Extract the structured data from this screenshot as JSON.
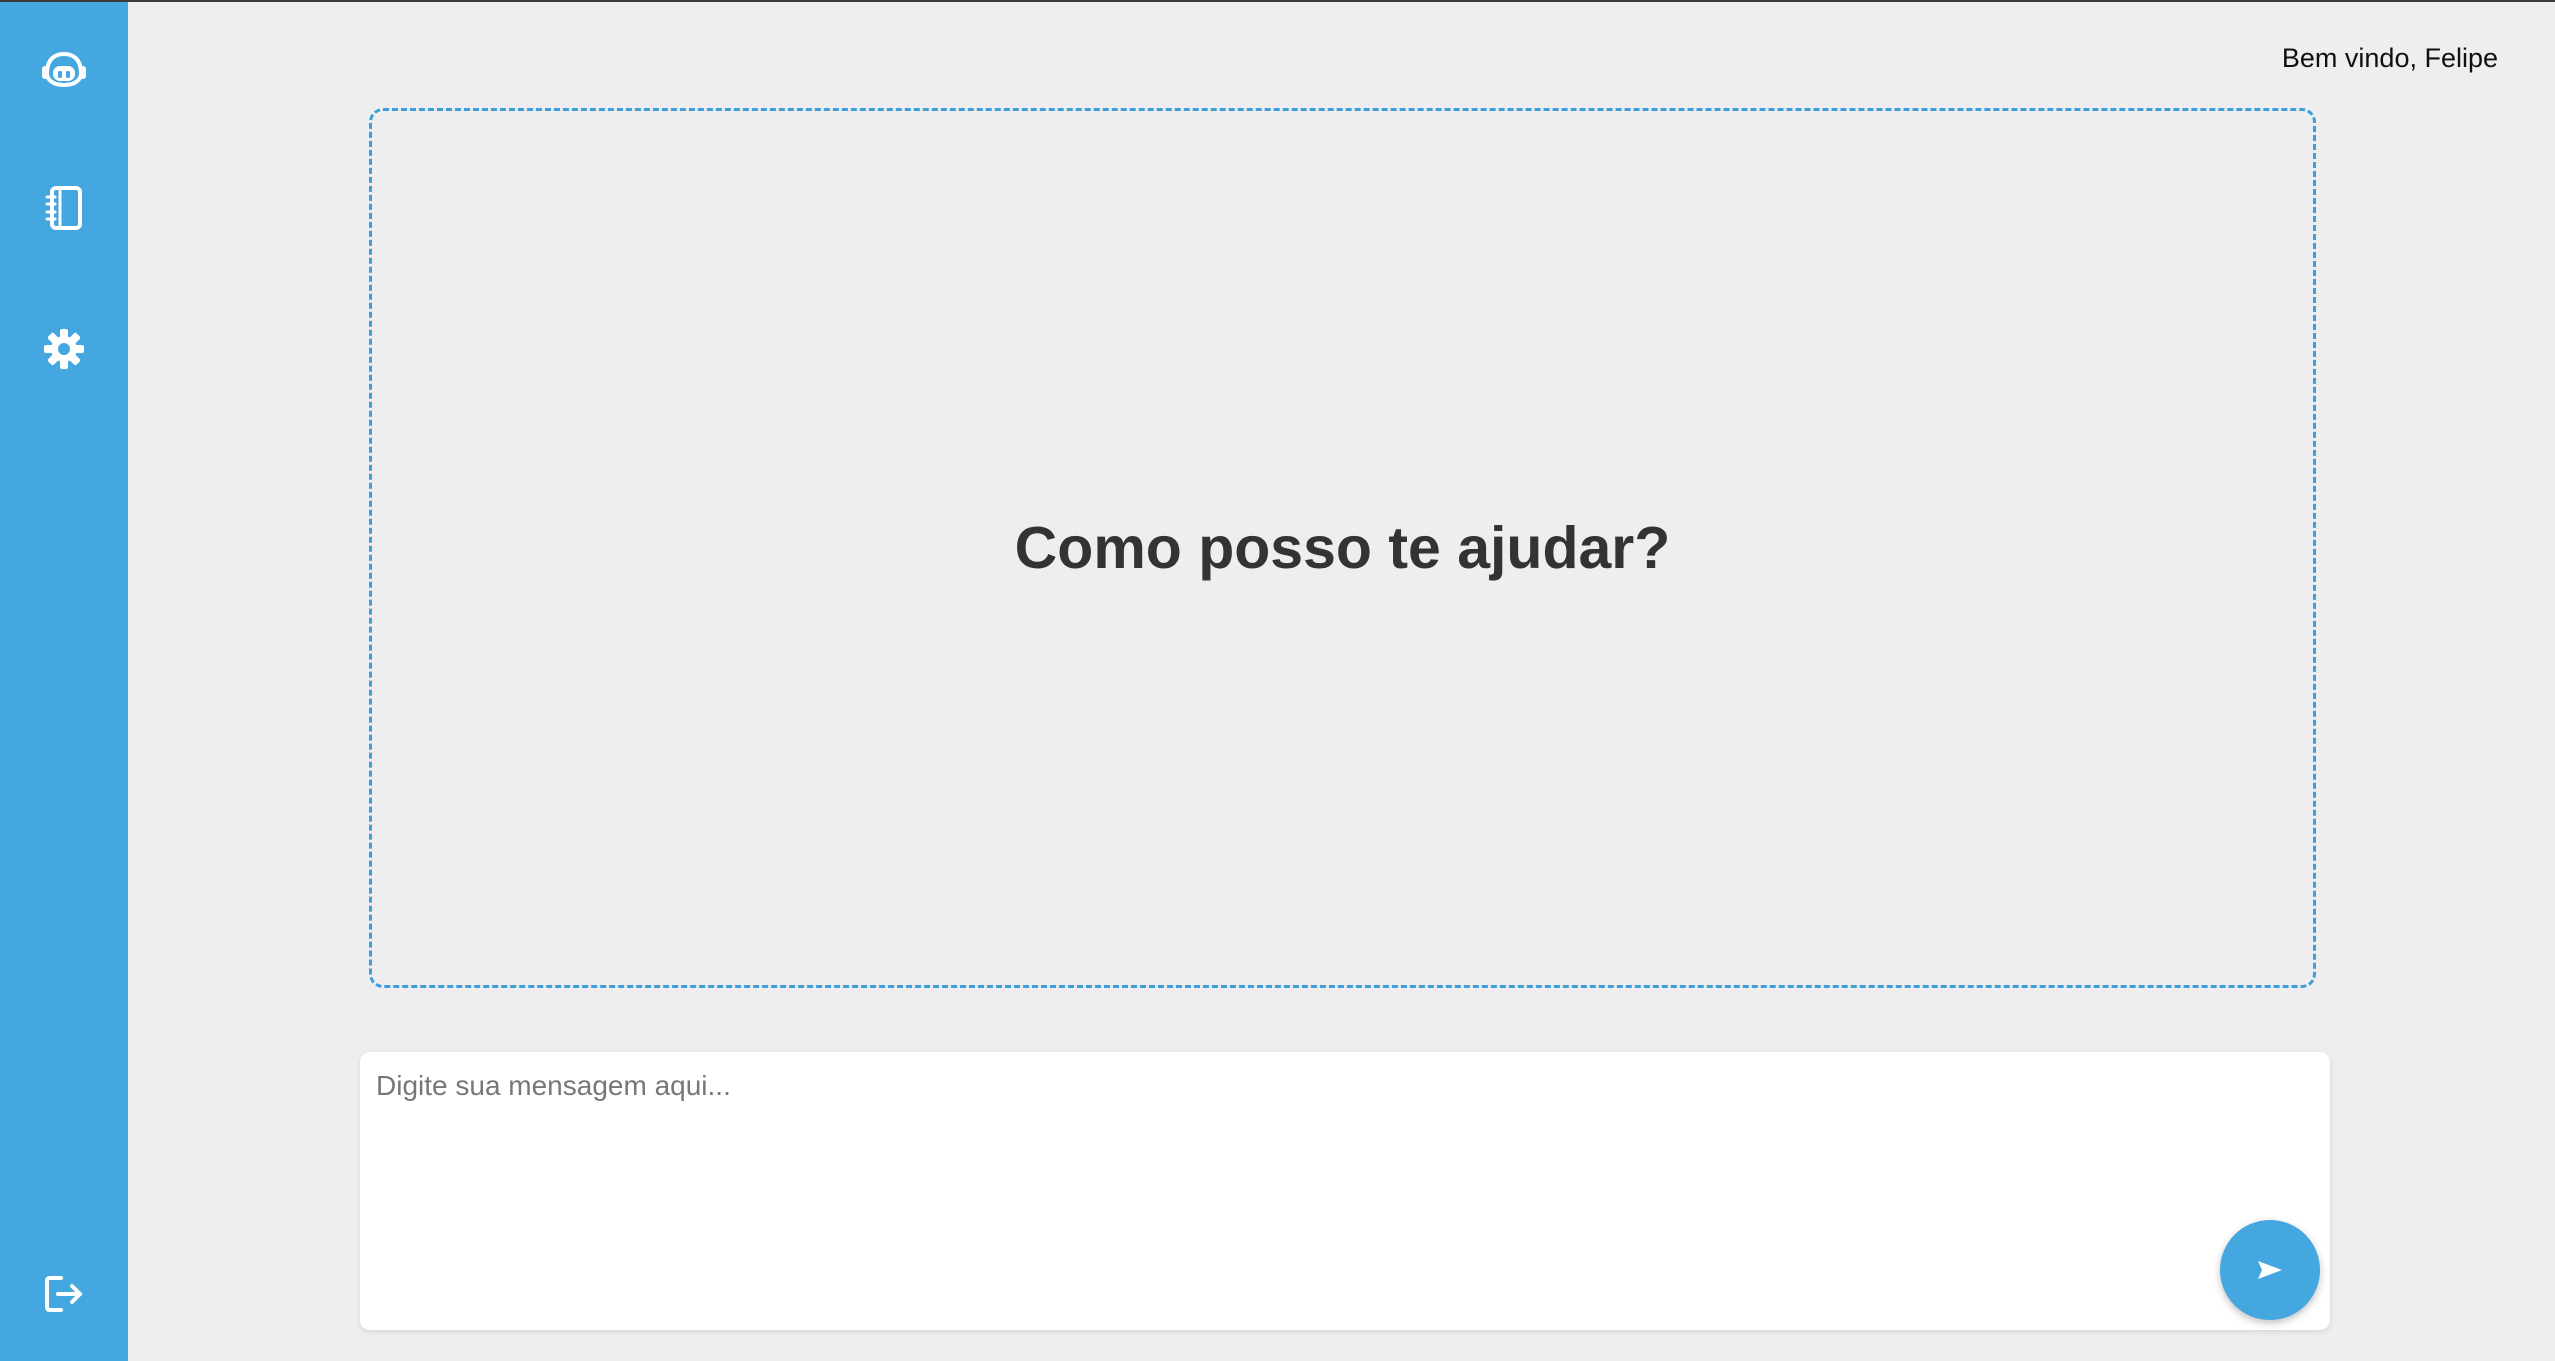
{
  "header": {
    "welcome_text": "Bem vindo, Felipe"
  },
  "sidebar": {
    "items": [
      {
        "icon": "robot-icon"
      },
      {
        "icon": "notebook-icon"
      },
      {
        "icon": "gear-icon"
      }
    ],
    "bottom": {
      "icon": "logout-icon"
    }
  },
  "main": {
    "heading": "Como posso te ajudar?"
  },
  "composer": {
    "placeholder": "Digite sua mensagem aqui...",
    "value": "",
    "send_icon": "send-icon"
  },
  "colors": {
    "accent": "#45a7e0",
    "background": "#eeeeee",
    "heading": "#333333"
  }
}
